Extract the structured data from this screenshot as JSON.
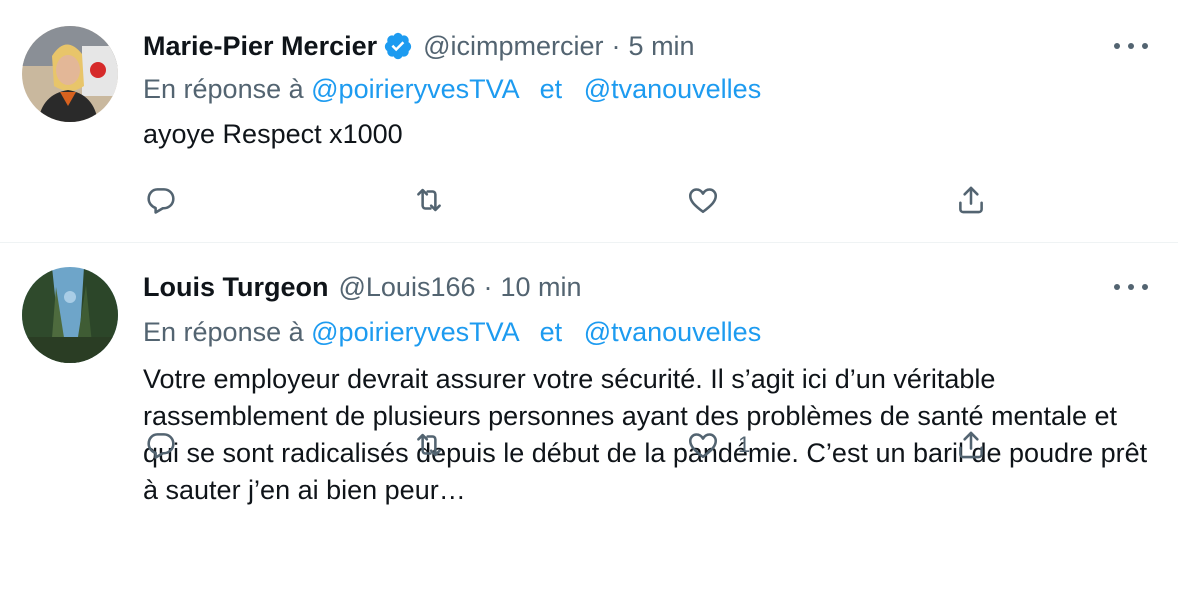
{
  "tweets": [
    {
      "name": "Marie-Pier Mercier",
      "verified": true,
      "handle": "@icimpmercier",
      "separator": "·",
      "time": "5 min",
      "reply_prefix": "En réponse à",
      "mention1": "@poirieryvesTVA",
      "conjunction": "et",
      "mention2": "@tvanouvelles",
      "text": "ayoye Respect x1000",
      "like_count": ""
    },
    {
      "name": "Louis Turgeon",
      "verified": false,
      "handle": "@Louis166",
      "separator": "·",
      "time": "10 min",
      "reply_prefix": "En réponse à",
      "mention1": "@poirieryvesTVA",
      "conjunction": "et",
      "mention2": "@tvanouvelles",
      "text": "Votre employeur devrait assurer votre sécurité. Il s’agit ici d’un véritable rassemblement de plusieurs personnes ayant des problèmes de santé mentale et qui se sont radicalisés depuis le début de la pandémie. C’est un baril de poudre prêt à sauter j’en ai bien peur…",
      "like_count": "1"
    }
  ],
  "colors": {
    "accent": "#1d9bf0",
    "text_primary": "#0f1419",
    "text_secondary": "#536471",
    "divider": "#eff3f4"
  },
  "icons": {
    "verified": "verified-badge-icon",
    "more": "more-options-icon",
    "reply": "reply-icon",
    "retweet": "retweet-icon",
    "like": "heart-icon",
    "share": "share-icon"
  }
}
